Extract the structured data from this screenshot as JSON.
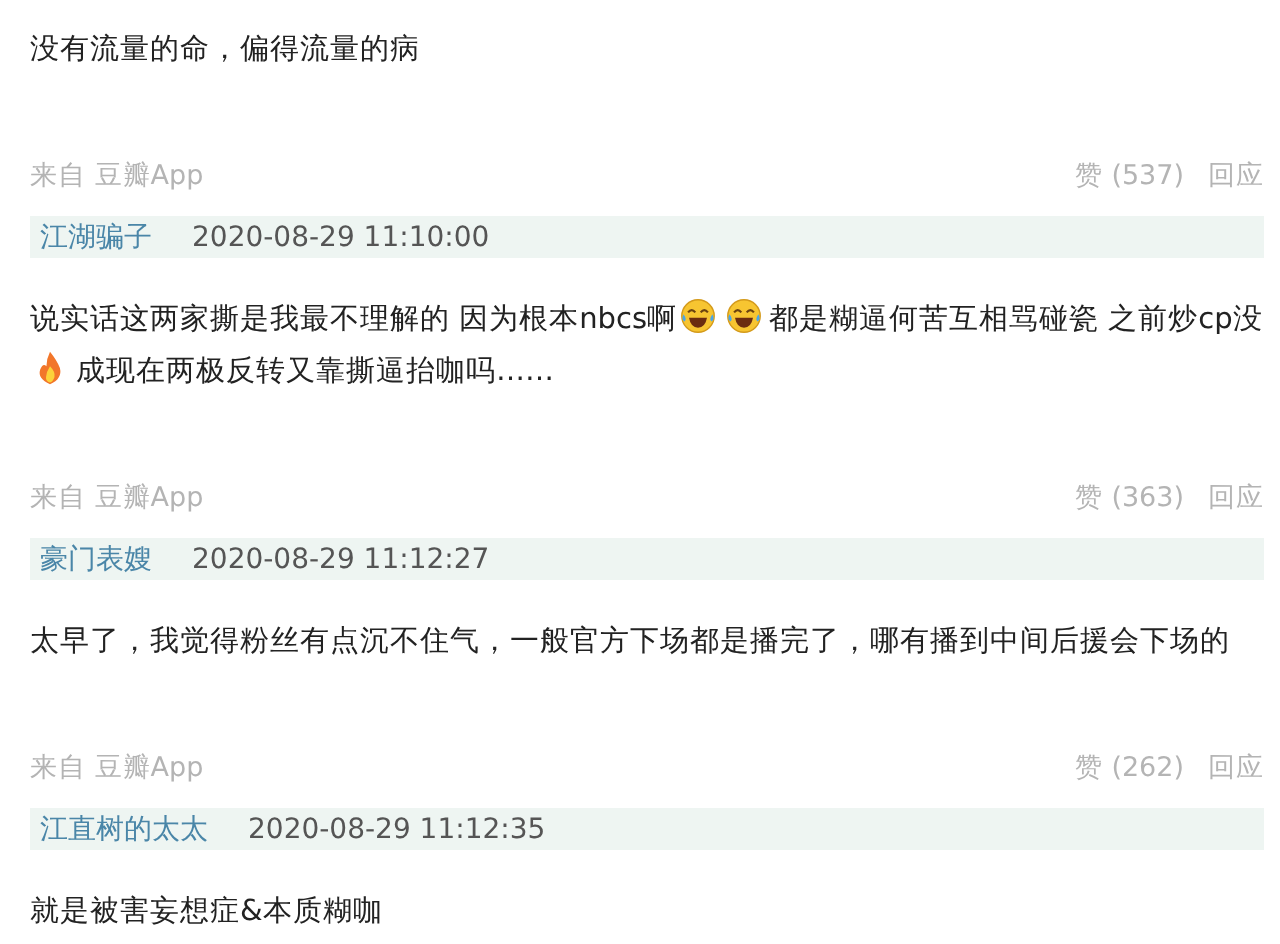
{
  "lead_body": [
    {
      "kind": "text",
      "text": "没有流量的命，偏得流量的病"
    }
  ],
  "comments": [
    {
      "source": "来自 豆瓣App",
      "likes": "赞 (537)",
      "reply": "回应",
      "author": "江湖骗子",
      "time": "2020-08-29 11:10:00",
      "body": [
        {
          "kind": "text",
          "text": "说实话这两家撕是我最不理解的 因为根本nbcs啊"
        },
        {
          "kind": "laugh"
        },
        {
          "kind": "laugh"
        },
        {
          "kind": "text",
          "text": "都是糊逼何苦互相骂碰瓷 之前炒cp"
        },
        {
          "kind": "text",
          "text": "没"
        },
        {
          "kind": "fire"
        },
        {
          "kind": "text",
          "text": "成现在两极反转又靠撕逼抬咖吗……"
        }
      ]
    },
    {
      "source": "来自 豆瓣App",
      "likes": "赞 (363)",
      "reply": "回应",
      "author": "豪门表嫂",
      "time": "2020-08-29 11:12:27",
      "body": [
        {
          "kind": "text",
          "text": "太早了，我觉得粉丝有点沉不住气，一般官方下场都是播完了，哪有播到中间后援会下场的"
        }
      ]
    },
    {
      "source": "来自 豆瓣App",
      "likes": "赞 (262)",
      "reply": "回应",
      "author": "江直树的太太",
      "time": "2020-08-29 11:12:35",
      "body": [
        {
          "kind": "text",
          "text": "就是被害妄想症&本质糊咖"
        }
      ]
    }
  ]
}
